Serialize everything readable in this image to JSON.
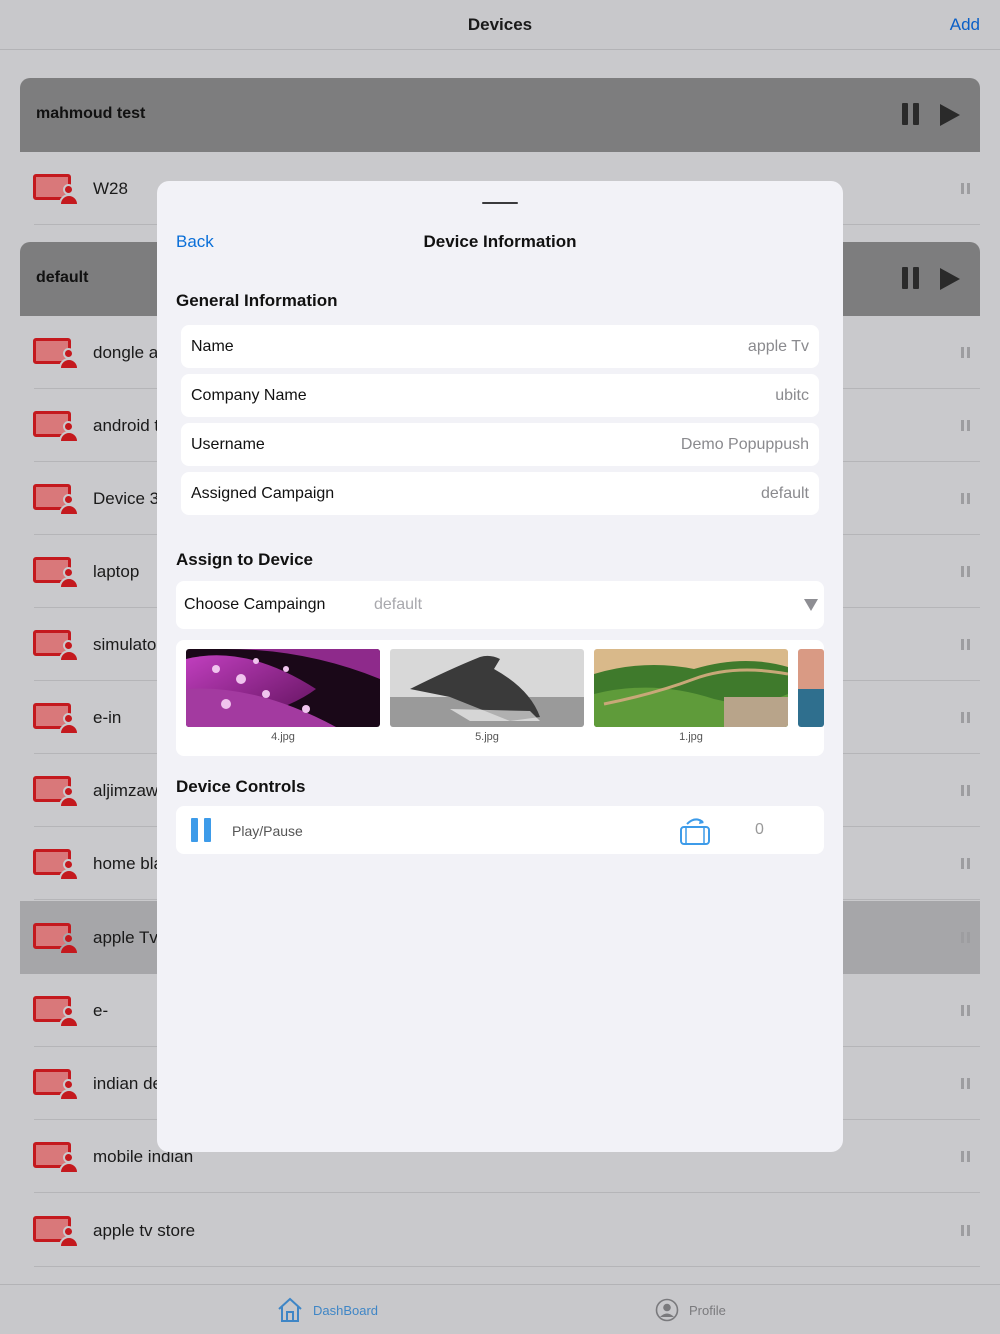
{
  "navbar": {
    "title": "Devices",
    "add_label": "Add"
  },
  "groups": [
    {
      "name": "mahmoud test"
    },
    {
      "name": "default"
    }
  ],
  "devices": [
    {
      "name": "W28"
    },
    {
      "name": "dongle a"
    },
    {
      "name": "android t"
    },
    {
      "name": "Device 3"
    },
    {
      "name": "laptop"
    },
    {
      "name": "simulato"
    },
    {
      "name": "e-in"
    },
    {
      "name": "aljimzaw"
    },
    {
      "name": "home bla"
    },
    {
      "name": "apple Tv"
    },
    {
      "name": "e-"
    },
    {
      "name": "indian de"
    },
    {
      "name": "mobile indian"
    },
    {
      "name": "apple tv store"
    }
  ],
  "tabbar": {
    "dashboard_label": "DashBoard",
    "profile_label": "Profile"
  },
  "sheet": {
    "back_label": "Back",
    "title": "Device Information",
    "general_section": "General Information",
    "info": [
      {
        "label": "Name",
        "value": "apple Tv"
      },
      {
        "label": "Company Name",
        "value": "ubitc"
      },
      {
        "label": "Username",
        "value": "Demo Popuppush"
      },
      {
        "label": "Assigned Campaign",
        "value": "default"
      }
    ],
    "assign_section": "Assign to Device",
    "choose_label": "Choose Campaingn",
    "choose_value": "default",
    "gallery": [
      {
        "caption": "4.jpg"
      },
      {
        "caption": "5.jpg"
      },
      {
        "caption": "1.jpg"
      }
    ],
    "controls_section": "Device Controls",
    "control_label": "Play/Pause",
    "control_count": "0"
  }
}
